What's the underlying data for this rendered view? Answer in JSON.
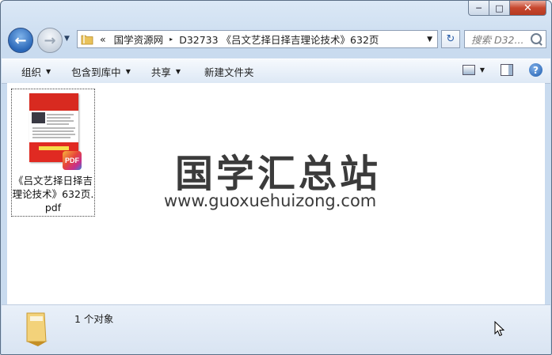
{
  "window": {
    "minimize_glyph": "─",
    "maximize_glyph": "□",
    "close_glyph": "✕"
  },
  "nav": {
    "back_glyph": "←",
    "forward_glyph": "→",
    "breadcrumb_overflow": "«",
    "breadcrumb": [
      "国学资源网",
      "D32733 《吕文艺择日择吉理论技术》632页"
    ],
    "breadcrumb_sep": "▸",
    "refresh_glyph": "↻",
    "search_placeholder": "搜索 D32..."
  },
  "toolbar": {
    "organize": "组织",
    "include_in_library": "包含到库中",
    "share": "共享",
    "new_folder": "新建文件夹",
    "dropdown_glyph": "▼",
    "help_glyph": "?"
  },
  "files": [
    {
      "name": "《吕文艺择日择吉理论技术》632页.pdf",
      "badge": "PDF"
    }
  ],
  "watermark": {
    "brand": "国学汇总站",
    "url": "www.guoxuehuizong.com"
  },
  "status": {
    "item_count": "1 个对象"
  },
  "colors": {
    "pdf_cover_red": "#d82a20",
    "accent_blue": "#2a67b8"
  }
}
